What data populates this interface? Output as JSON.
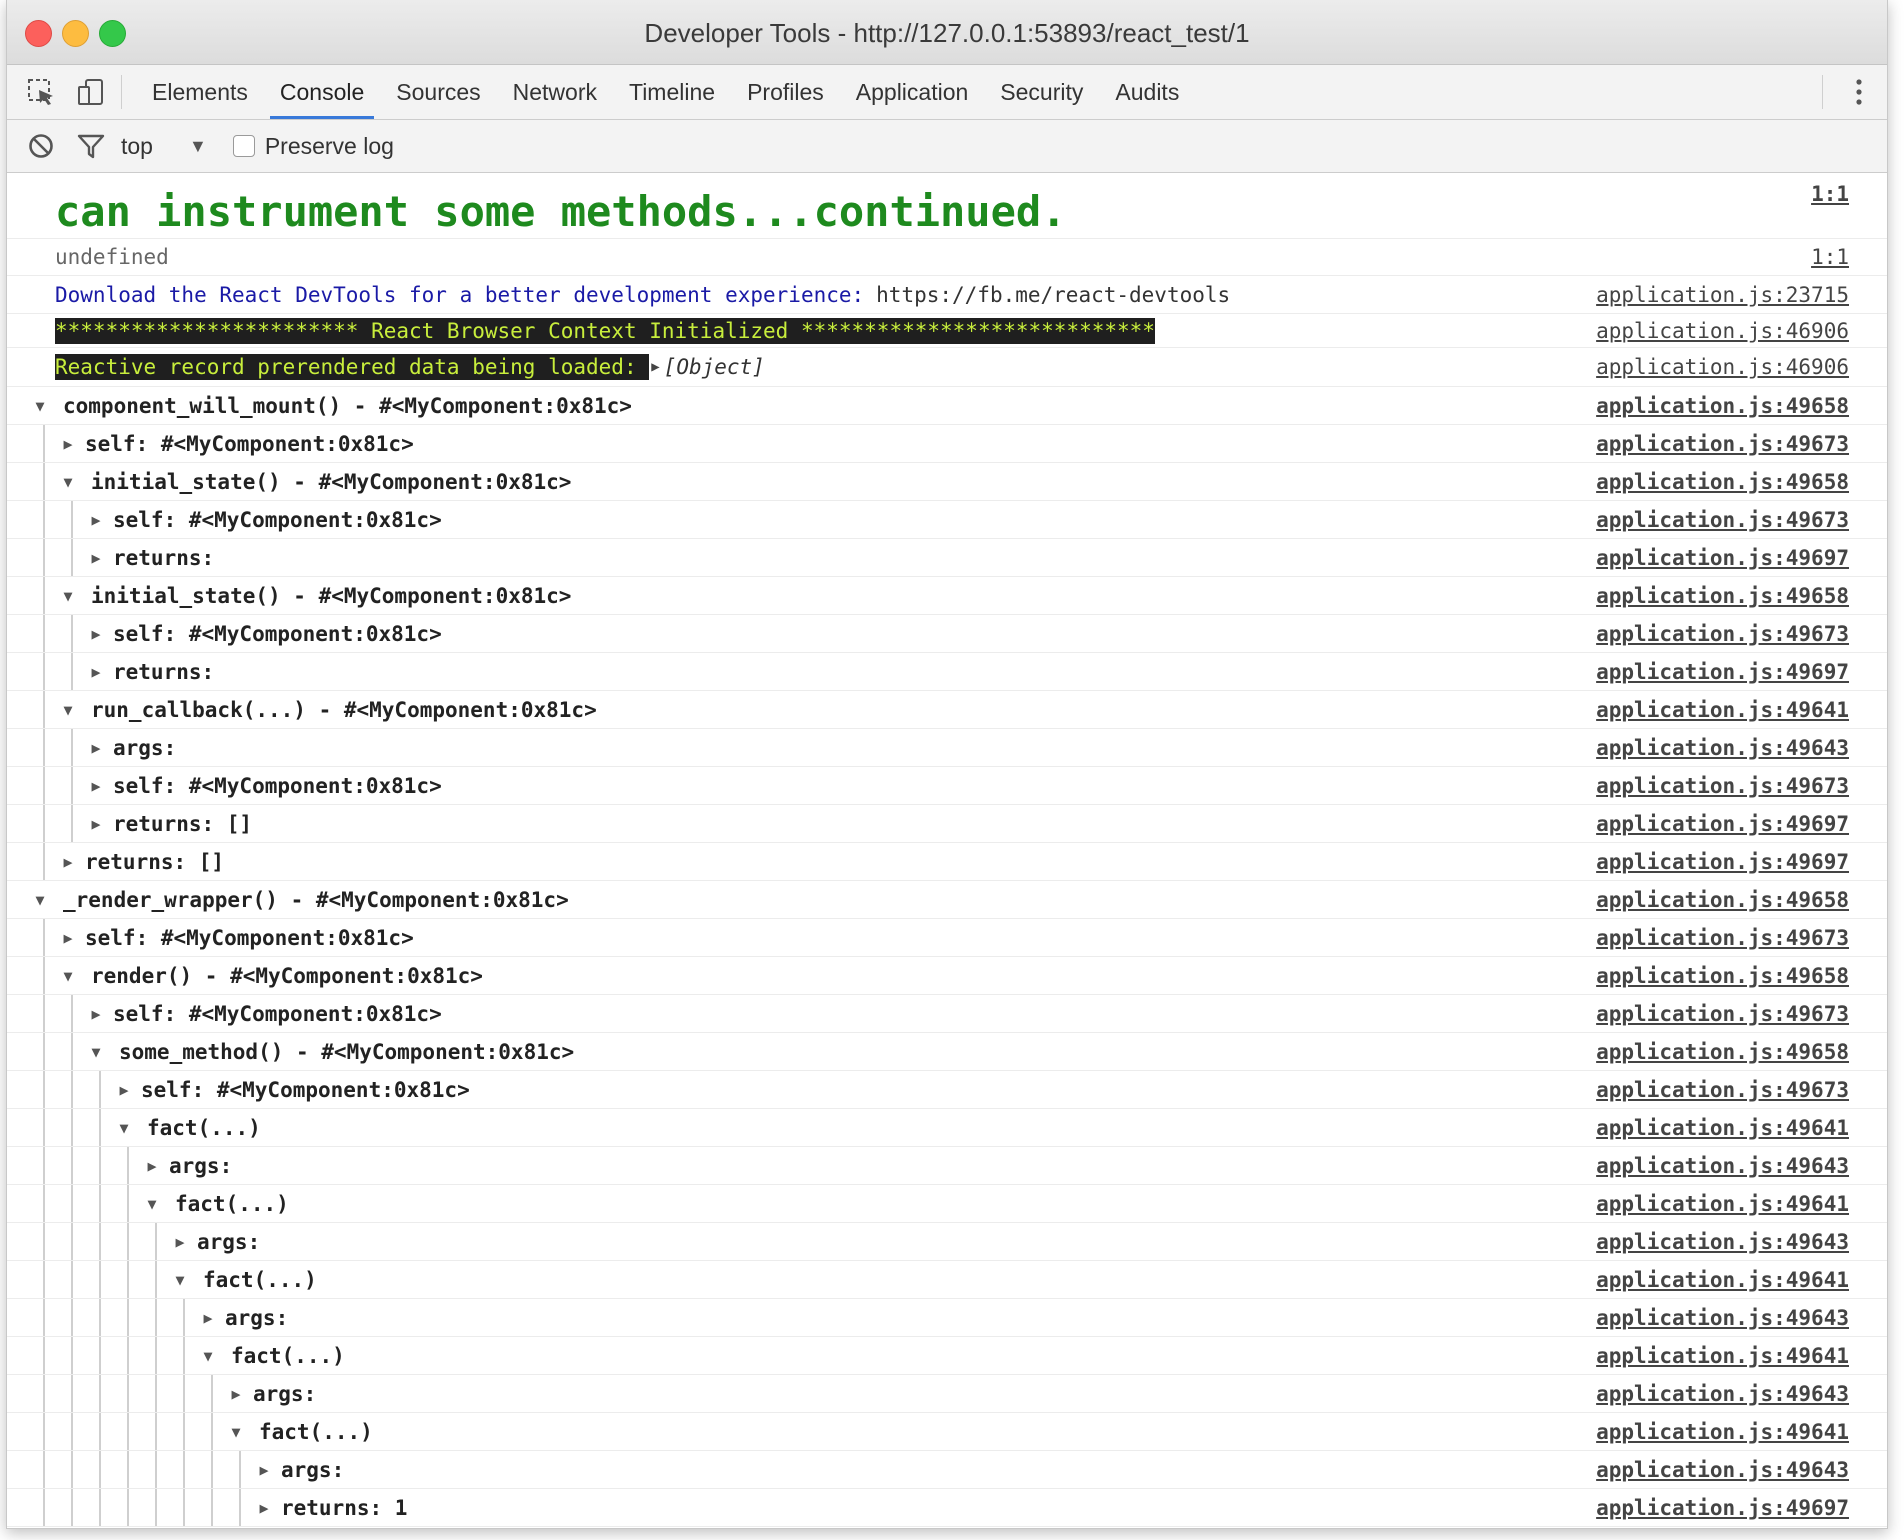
{
  "window": {
    "title": "Developer Tools - http://127.0.0.1:53893/react_test/1"
  },
  "tabs": [
    {
      "label": "Elements"
    },
    {
      "label": "Console"
    },
    {
      "label": "Sources"
    },
    {
      "label": "Network"
    },
    {
      "label": "Timeline"
    },
    {
      "label": "Profiles"
    },
    {
      "label": "Application"
    },
    {
      "label": "Security"
    },
    {
      "label": "Audits"
    }
  ],
  "active_tab": "Console",
  "toolbar": {
    "context": "top",
    "context_arrow": "▼",
    "preserve_log": "Preserve log",
    "preserve_log_checked": false
  },
  "messages": {
    "m1": {
      "text": "can instrument some methods...continued.",
      "src": "1:1"
    },
    "m2": {
      "text": "undefined",
      "src": "1:1"
    },
    "m3": {
      "text": "Download the React DevTools for a better development experience:",
      "url": "https://fb.me/react-devtools",
      "src": "application.js:23715"
    },
    "m4": {
      "text": "************************ React Browser Context Initialized ****************************",
      "src": "application.js:46906"
    },
    "m5": {
      "text": "Reactive record prerendered data being loaded: ",
      "obj": "[Object]",
      "src": "application.js:46906"
    }
  },
  "groups": [
    {
      "label": "component_will_mount() - #<MyComponent:0x81c>",
      "src": "application.js:49658"
    },
    {
      "label": "self: #<MyComponent:0x81c>",
      "src": "application.js:49673"
    },
    {
      "label": "initial_state() - #<MyComponent:0x81c>",
      "src": "application.js:49658"
    },
    {
      "label": "self: #<MyComponent:0x81c>",
      "src": "application.js:49673"
    },
    {
      "label": "returns:",
      "src": "application.js:49697"
    },
    {
      "label": "initial_state() - #<MyComponent:0x81c>",
      "src": "application.js:49658"
    },
    {
      "label": "self: #<MyComponent:0x81c>",
      "src": "application.js:49673"
    },
    {
      "label": "returns:",
      "src": "application.js:49697"
    },
    {
      "label": "run_callback(...) - #<MyComponent:0x81c>",
      "src": "application.js:49641"
    },
    {
      "label": "args:",
      "src": "application.js:49643"
    },
    {
      "label": "self: #<MyComponent:0x81c>",
      "src": "application.js:49673"
    },
    {
      "label": "returns: []",
      "src": "application.js:49697"
    },
    {
      "label": "returns: []",
      "src": "application.js:49697"
    },
    {
      "label": "_render_wrapper() - #<MyComponent:0x81c>",
      "src": "application.js:49658"
    },
    {
      "label": "self: #<MyComponent:0x81c>",
      "src": "application.js:49673"
    },
    {
      "label": "render() - #<MyComponent:0x81c>",
      "src": "application.js:49658"
    },
    {
      "label": "self: #<MyComponent:0x81c>",
      "src": "application.js:49673"
    },
    {
      "label": "some_method() - #<MyComponent:0x81c>",
      "src": "application.js:49658"
    },
    {
      "label": "self: #<MyComponent:0x81c>",
      "src": "application.js:49673"
    },
    {
      "label": "fact(...)",
      "src": "application.js:49641"
    },
    {
      "label": "args:",
      "src": "application.js:49643"
    },
    {
      "label": "fact(...)",
      "src": "application.js:49641"
    },
    {
      "label": "args:",
      "src": "application.js:49643"
    },
    {
      "label": "fact(...)",
      "src": "application.js:49641"
    },
    {
      "label": "args:",
      "src": "application.js:49643"
    },
    {
      "label": "fact(...)",
      "src": "application.js:49641"
    },
    {
      "label": "args:",
      "src": "application.js:49643"
    },
    {
      "label": "fact(...)",
      "src": "application.js:49641"
    },
    {
      "label": "args:",
      "src": "application.js:49643"
    },
    {
      "label": "returns: 1",
      "src": "application.js:49697"
    }
  ],
  "colors": {
    "accent": "#3879d9",
    "green_log": "#1e8a1e",
    "link_blue": "#1a1aa6",
    "highlight_fg": "#c8ee3c"
  }
}
